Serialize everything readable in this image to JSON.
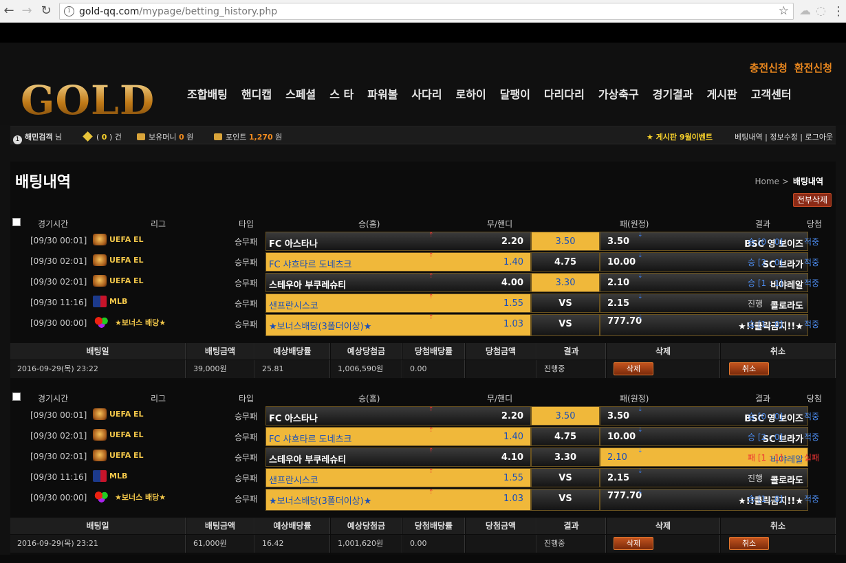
{
  "browser": {
    "url_host": "gold-qq.com",
    "url_path": "/mypage/betting_history.php"
  },
  "site": {
    "logo": "GOLD",
    "top_links": [
      "충전신청",
      "환전신청"
    ],
    "nav": [
      "조합배팅",
      "핸디캡",
      "스페셜",
      "스 타",
      "파워볼",
      "사다리",
      "로하이",
      "달팽이",
      "다리다리",
      "가상축구",
      "경기결과",
      "게시판",
      "고객센터"
    ]
  },
  "infobar": {
    "user_num": "1",
    "user_name": "해민검객",
    "user_suffix": "님",
    "msg_prefix": "(",
    "msg_count": "0",
    "msg_suffix": ") 건",
    "money_label": "보유머니",
    "money_value": "0",
    "money_unit": "원",
    "point_label": "포인트",
    "point_value": "1,270",
    "point_unit": "원",
    "ticker": "★ 게시판 9월이벤트",
    "right_links": "베팅내역 | 정보수정 | 로그아웃"
  },
  "page": {
    "title": "배팅내역",
    "crumb_home": "Home >",
    "crumb_current": "배팅내역",
    "delete_all": "전부삭제"
  },
  "table_headers": {
    "time": "경기시간",
    "league": "리그",
    "type": "타입",
    "home": "승(홈)",
    "draw": "무/핸디",
    "away": "패(원정)",
    "result": "결과",
    "win": "당첨"
  },
  "summary_headers": [
    "배팅일",
    "배팅금액",
    "예상배당률",
    "예상당첨금",
    "당첨배당률",
    "당첨금액",
    "결과",
    "삭제",
    "취소"
  ],
  "buttons": {
    "delete": "삭제",
    "cancel": "취소"
  },
  "bets": [
    {
      "rows": [
        {
          "time": "[09/30 00:01]",
          "league_icon": "uefa",
          "league": "UEFA EL",
          "type": "승무패",
          "home": "FC 아스타나",
          "home_odds": "2.20",
          "home_sel": false,
          "mid": "3.50",
          "mid_sel": true,
          "away_odds": "3.50",
          "away": "BSC 영 보이즈",
          "away_sel": false,
          "result": "승 [0 : 0]",
          "result_color": "blue",
          "win": "적중",
          "win_color": "blue"
        },
        {
          "time": "[09/30 02:01]",
          "league_icon": "uefa",
          "league": "UEFA EL",
          "type": "승무패",
          "home": "FC 샤흐타르 도네츠크",
          "home_odds": "1.40",
          "home_sel": true,
          "mid": "4.75",
          "mid_sel": false,
          "away_odds": "10.00",
          "away": "SC 브라가",
          "away_sel": false,
          "result": "승 [2 : 0]",
          "result_color": "blue",
          "win": "적중",
          "win_color": "blue"
        },
        {
          "time": "[09/30 02:01]",
          "league_icon": "uefa",
          "league": "UEFA EL",
          "type": "승무패",
          "home": "스테우아 부쿠레슈티",
          "home_odds": "4.00",
          "home_sel": false,
          "mid": "3.30",
          "mid_sel": true,
          "away_odds": "2.10",
          "away": "비야레알",
          "away_sel": false,
          "result": "승 [1 : 1]",
          "result_color": "blue",
          "win": "적중",
          "win_color": "blue"
        },
        {
          "time": "[09/30 11:16]",
          "league_icon": "mlb",
          "league": "MLB",
          "type": "승무패",
          "home": "샌프란시스코",
          "home_odds": "1.55",
          "home_sel": true,
          "mid": "VS",
          "mid_sel": false,
          "away_odds": "2.15",
          "away": "콜로라도",
          "away_sel": false,
          "result": "진행",
          "result_color": "gray",
          "win": "",
          "win_color": "blue"
        },
        {
          "time": "[09/30 00:00]",
          "league_icon": "bonus",
          "league": "★보너스 배당★",
          "type": "승무패",
          "home": "★보너스배당(3폴더이상)★",
          "home_odds": "1.03",
          "home_sel": true,
          "mid": "VS",
          "mid_sel": false,
          "away_odds": "777.70",
          "away": "★!!클릭금지!!★",
          "away_sel": false,
          "result": "승 [1 : 0]",
          "result_color": "blue",
          "win": "적중",
          "win_color": "blue"
        }
      ],
      "summary": [
        "2016-09-29(목) 23:22",
        "39,000원",
        "25.81",
        "1,006,590원",
        "0.00",
        "",
        "진행중"
      ]
    },
    {
      "rows": [
        {
          "time": "[09/30 00:01]",
          "league_icon": "uefa",
          "league": "UEFA EL",
          "type": "승무패",
          "home": "FC 아스타나",
          "home_odds": "2.20",
          "home_sel": false,
          "mid": "3.50",
          "mid_sel": true,
          "away_odds": "3.50",
          "away": "BSC 영 보이즈",
          "away_sel": false,
          "result": "승 [0 : 0]",
          "result_color": "blue",
          "win": "적중",
          "win_color": "blue"
        },
        {
          "time": "[09/30 02:01]",
          "league_icon": "uefa",
          "league": "UEFA EL",
          "type": "승무패",
          "home": "FC 샤흐타르 도네츠크",
          "home_odds": "1.40",
          "home_sel": true,
          "mid": "4.75",
          "mid_sel": false,
          "away_odds": "10.00",
          "away": "SC 브라가",
          "away_sel": false,
          "result": "승 [2 : 0]",
          "result_color": "blue",
          "win": "적중",
          "win_color": "blue"
        },
        {
          "time": "[09/30 02:01]",
          "league_icon": "uefa",
          "league": "UEFA EL",
          "type": "승무패",
          "home": "스테우아 부쿠레슈티",
          "home_odds": "4.10",
          "home_sel": false,
          "mid": "3.30",
          "mid_sel": false,
          "away_odds": "2.10",
          "away": "비야레알",
          "away_sel": true,
          "result": "패 [1 : 1]",
          "result_color": "red",
          "win": "실패",
          "win_color": "red"
        },
        {
          "time": "[09/30 11:16]",
          "league_icon": "mlb",
          "league": "MLB",
          "type": "승무패",
          "home": "샌프란시스코",
          "home_odds": "1.55",
          "home_sel": true,
          "mid": "VS",
          "mid_sel": false,
          "away_odds": "2.15",
          "away": "콜로라도",
          "away_sel": false,
          "result": "진행",
          "result_color": "gray",
          "win": "",
          "win_color": "blue"
        },
        {
          "time": "[09/30 00:00]",
          "league_icon": "bonus",
          "league": "★보너스 배당★",
          "type": "승무패",
          "home": "★보너스배당(3폴더이상)★",
          "home_odds": "1.03",
          "home_sel": true,
          "mid": "VS",
          "mid_sel": false,
          "away_odds": "777.70",
          "away": "★!!클릭금지!!★",
          "away_sel": false,
          "result": "승 [1 : 0]",
          "result_color": "blue",
          "win": "적중",
          "win_color": "blue"
        }
      ],
      "summary": [
        "2016-09-29(목) 23:21",
        "61,000원",
        "16.42",
        "1,001,620원",
        "0.00",
        "",
        "진행중"
      ]
    }
  ]
}
